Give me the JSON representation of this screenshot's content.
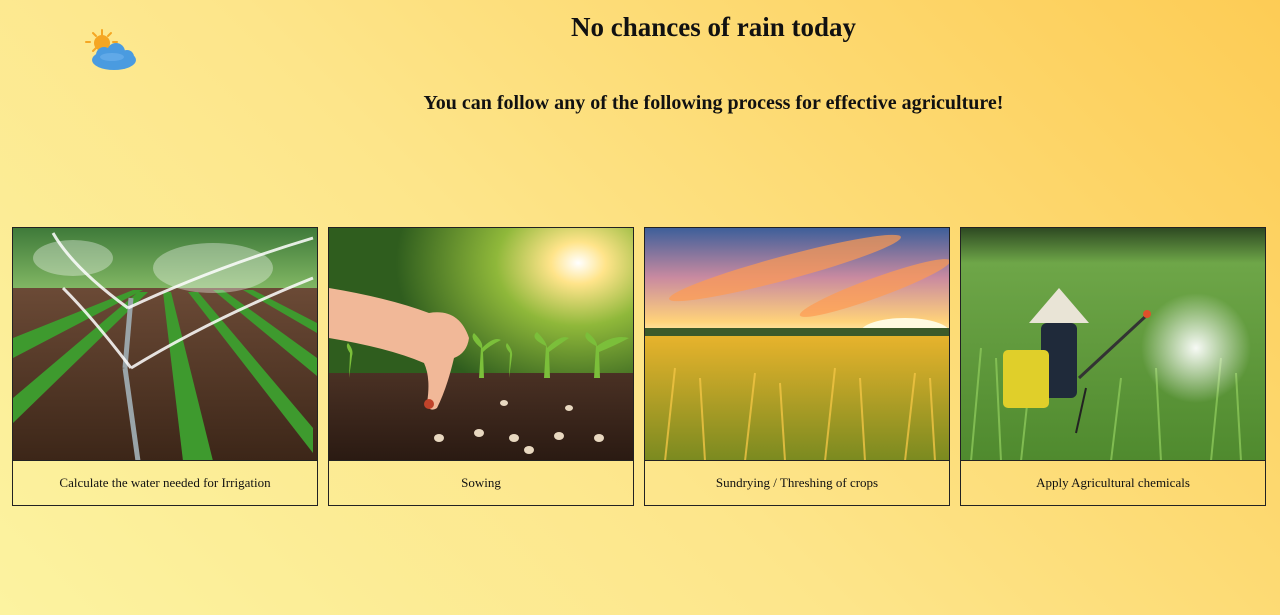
{
  "header": {
    "weather_icon": "sun-behind-cloud-icon",
    "title": "No chances of rain today",
    "subtitle": "You can follow any of the following process for effective agriculture!"
  },
  "cards": [
    {
      "image": "irrigation-sprinklers-image",
      "caption": "Calculate the water needed for Irrigation"
    },
    {
      "image": "sowing-seeds-image",
      "caption": "Sowing"
    },
    {
      "image": "golden-crop-field-image",
      "caption": "Sundrying / Threshing of crops"
    },
    {
      "image": "farmer-spraying-chemicals-image",
      "caption": "Apply Agricultural chemicals"
    }
  ],
  "colors": {
    "background_start": "#fcf3a0",
    "background_end": "#fdcc55",
    "cloud": "#4a9be0",
    "sun": "#f5a623"
  }
}
